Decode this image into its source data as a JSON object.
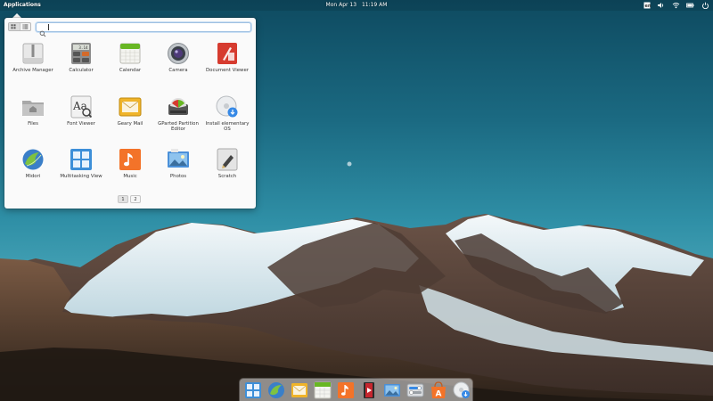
{
  "top_panel": {
    "applications_label": "Applications",
    "date": "Mon Apr 13",
    "time": "11:19 AM",
    "indicators": [
      "keyboard-icon",
      "volume-icon",
      "wifi-icon",
      "battery-icon",
      "power-icon"
    ]
  },
  "app_menu": {
    "search": {
      "value": "",
      "placeholder": ""
    },
    "views": [
      "grid-view-icon",
      "category-view-icon"
    ],
    "active_view": "grid-view-icon",
    "apps": [
      {
        "label": "Archive Manager",
        "icon": "archive-manager-icon"
      },
      {
        "label": "Calculator",
        "icon": "calculator-icon"
      },
      {
        "label": "Calendar",
        "icon": "calendar-icon"
      },
      {
        "label": "Camera",
        "icon": "camera-icon"
      },
      {
        "label": "Document Viewer",
        "icon": "document-viewer-icon"
      },
      {
        "label": "Files",
        "icon": "files-icon"
      },
      {
        "label": "Font Viewer",
        "icon": "font-viewer-icon"
      },
      {
        "label": "Geary Mail",
        "icon": "mail-icon"
      },
      {
        "label": "GParted Partition Editor",
        "icon": "gparted-icon"
      },
      {
        "label": "Install elementary OS",
        "icon": "installer-icon"
      },
      {
        "label": "Midori",
        "icon": "midori-icon"
      },
      {
        "label": "Multitasking View",
        "icon": "multitasking-icon"
      },
      {
        "label": "Music",
        "icon": "music-icon"
      },
      {
        "label": "Photos",
        "icon": "photos-icon"
      },
      {
        "label": "Scratch",
        "icon": "scratch-icon"
      }
    ],
    "calculator_display": "3.14",
    "pages": [
      "1",
      "2"
    ],
    "current_page": "1"
  },
  "dock": {
    "items": [
      "multitasking-icon",
      "midori-icon",
      "mail-icon",
      "calendar-icon",
      "music-icon",
      "videos-icon",
      "photos-icon",
      "settings-icon",
      "appcenter-icon",
      "installer-icon"
    ]
  }
}
